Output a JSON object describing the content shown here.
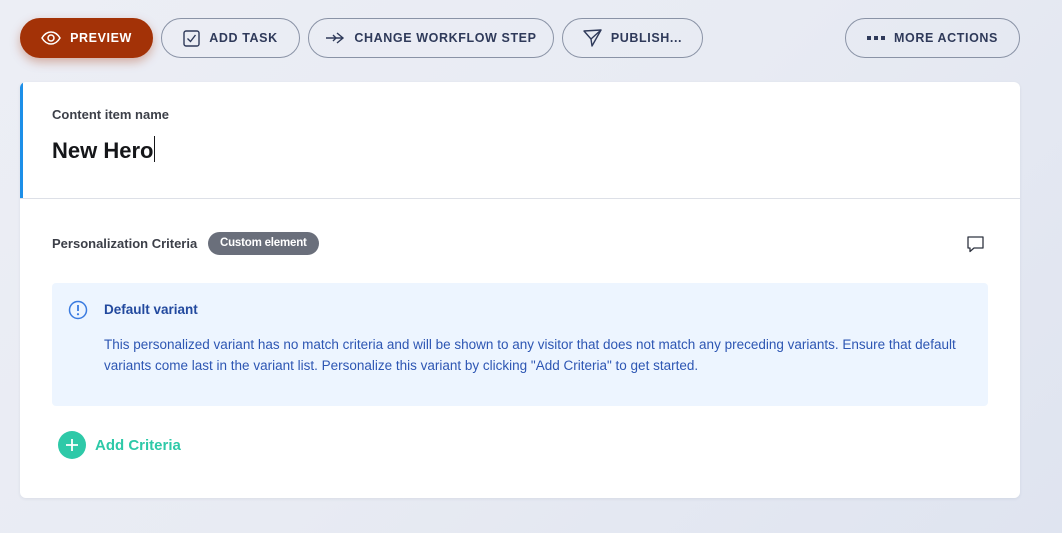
{
  "toolbar": {
    "preview_label": "PREVIEW",
    "add_task_label": "ADD TASK",
    "change_workflow_label": "CHANGE WORKFLOW STEP",
    "publish_label": "PUBLISH...",
    "more_actions_label": "MORE ACTIONS"
  },
  "content_item": {
    "name_label": "Content item name",
    "name_value": "New Hero"
  },
  "personalization": {
    "label": "Personalization Criteria",
    "badge": "Custom element",
    "info": {
      "title": "Default variant",
      "text": "This personalized variant has no match criteria and will be shown to any visitor that does not match any preceding variants. Ensure that default variants come last in the variant list. Personalize this variant by clicking \"Add Criteria\" to get started."
    },
    "add_criteria_label": "Add Criteria"
  },
  "icons": {
    "preview": "eye-icon",
    "add_task": "checkbox-icon",
    "change_workflow": "arrow-right-icon",
    "publish": "paper-plane-icon",
    "more_actions": "dots-icon",
    "comment": "comment-icon",
    "info": "info-icon",
    "add": "plus-icon"
  },
  "colors": {
    "primary": "#a33207",
    "accent_blue": "#1d8fe8",
    "success": "#2ec9a8",
    "info_bg": "#edf5ff",
    "info_text": "#2d56b3"
  }
}
